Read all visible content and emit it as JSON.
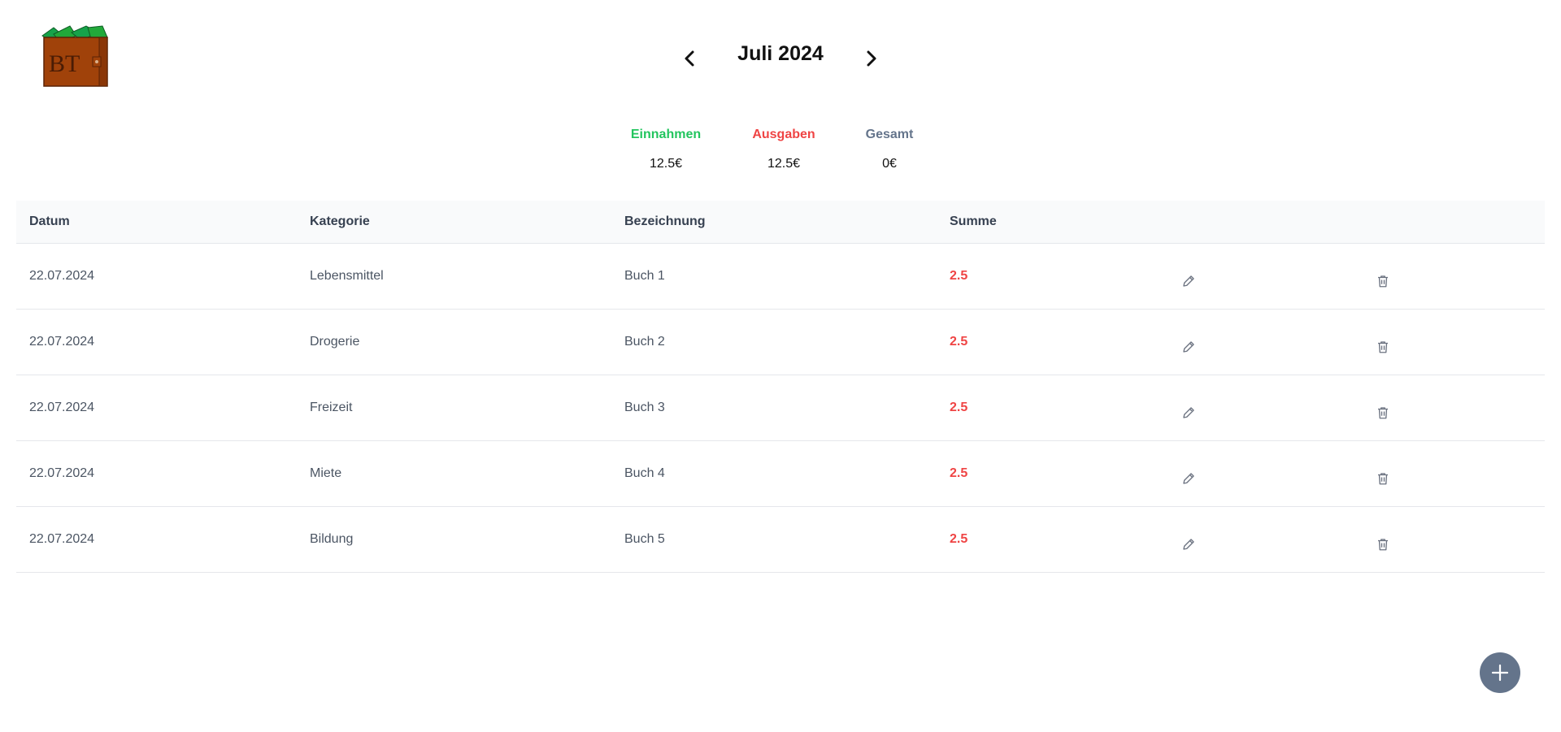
{
  "logo": {
    "text": "BT"
  },
  "month_nav": {
    "title": "Juli 2024",
    "prev_icon": "chevron-left-icon",
    "next_icon": "chevron-right-icon"
  },
  "summary": {
    "income": {
      "label": "Einnahmen",
      "value": "12.5€",
      "color": "#22c55e"
    },
    "expenses": {
      "label": "Ausgaben",
      "value": "12.5€",
      "color": "#ef4444"
    },
    "total": {
      "label": "Gesamt",
      "value": "0€",
      "color": "#64748b"
    }
  },
  "table": {
    "headers": {
      "date": "Datum",
      "category": "Kategorie",
      "description": "Bezeichnung",
      "sum": "Summe"
    },
    "rows": [
      {
        "date": "22.07.2024",
        "category": "Lebensmittel",
        "description": "Buch 1",
        "sum": "2.5"
      },
      {
        "date": "22.07.2024",
        "category": "Drogerie",
        "description": "Buch 2",
        "sum": "2.5"
      },
      {
        "date": "22.07.2024",
        "category": "Freizeit",
        "description": "Buch 3",
        "sum": "2.5"
      },
      {
        "date": "22.07.2024",
        "category": "Miete",
        "description": "Buch 4",
        "sum": "2.5"
      },
      {
        "date": "22.07.2024",
        "category": "Bildung",
        "description": "Buch 5",
        "sum": "2.5"
      }
    ],
    "row_actions": {
      "edit_icon": "pencil-icon",
      "delete_icon": "trash-icon"
    }
  },
  "fab": {
    "icon": "plus-icon",
    "color": "#64748b"
  }
}
